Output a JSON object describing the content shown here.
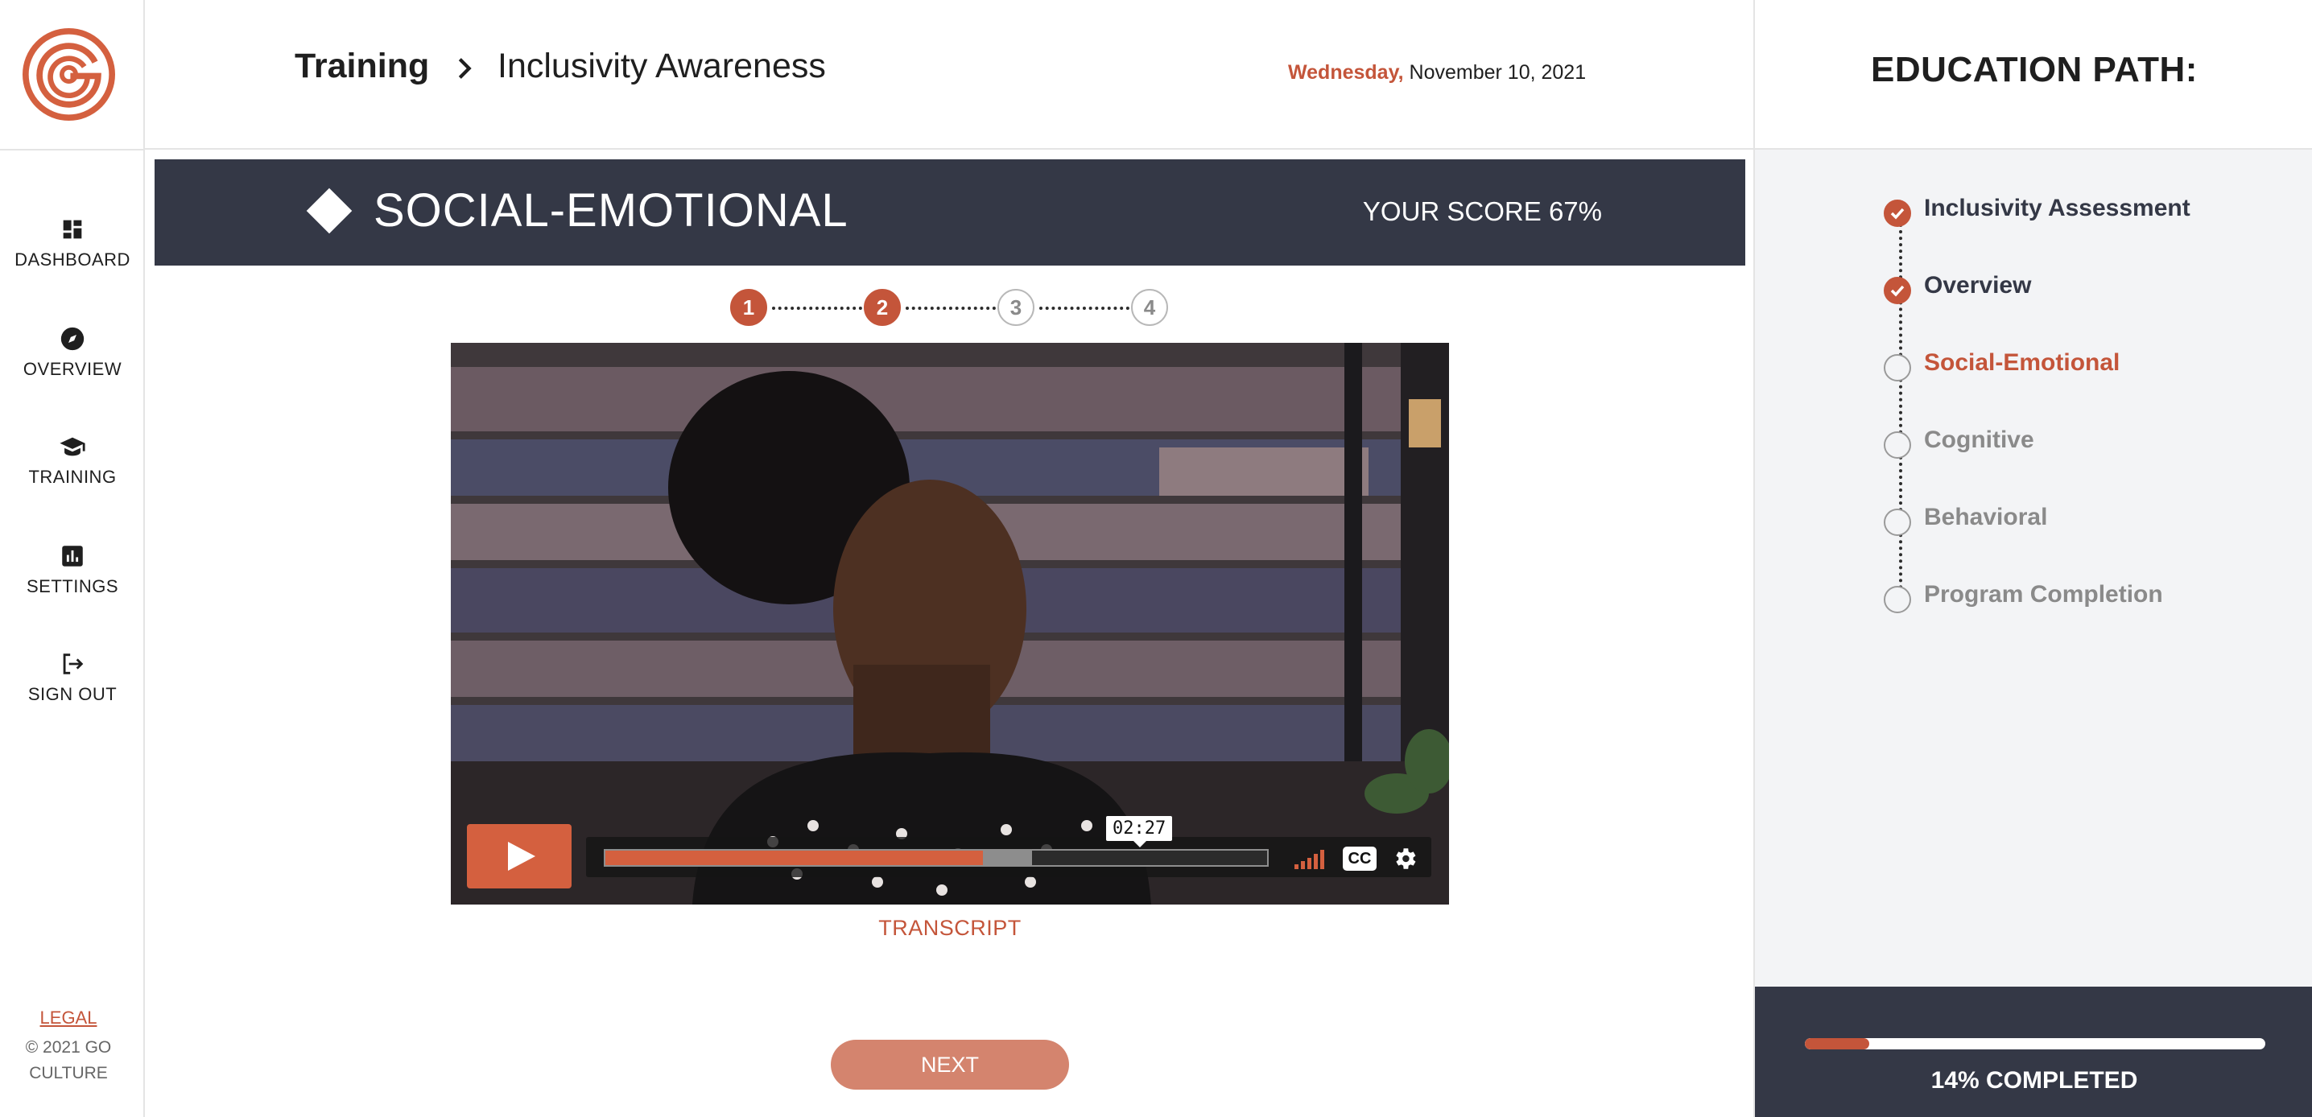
{
  "sidebar": {
    "items": [
      {
        "label": "DASHBOARD",
        "icon": "dashboard-icon"
      },
      {
        "label": "OVERVIEW",
        "icon": "compass-icon"
      },
      {
        "label": "TRAINING",
        "icon": "graduation-cap-icon"
      },
      {
        "label": "SETTINGS",
        "icon": "bar-chart-icon"
      },
      {
        "label": "SIGN OUT",
        "icon": "sign-out-icon"
      }
    ],
    "legal": "LEGAL",
    "copyright": "© 2021 GO CULTURE"
  },
  "header": {
    "breadcrumb_root": "Training",
    "breadcrumb_current": "Inclusivity Awareness",
    "date_day": "Wednesday,",
    "date_rest": " November 10, 2021"
  },
  "banner": {
    "title": "SOCIAL-EMOTIONAL",
    "score": "YOUR SCORE 67%"
  },
  "steps": [
    {
      "label": "1",
      "state": "done"
    },
    {
      "label": "2",
      "state": "done"
    },
    {
      "label": "3",
      "state": "todo"
    },
    {
      "label": "4",
      "state": "todo"
    }
  ],
  "video": {
    "time": "02:27",
    "played_fraction": 0.57,
    "buffered_fraction": 0.645,
    "cc_label": "CC"
  },
  "transcript_label": "TRANSCRIPT",
  "next_label": "NEXT",
  "education_path": {
    "title": "EDUCATION PATH:",
    "items": [
      {
        "label": "Inclusivity Assessment",
        "state": "done"
      },
      {
        "label": "Overview",
        "state": "done"
      },
      {
        "label": "Social-Emotional",
        "state": "active"
      },
      {
        "label": "Cognitive",
        "state": "todo"
      },
      {
        "label": "Behavioral",
        "state": "todo"
      },
      {
        "label": "Program Completion",
        "state": "todo"
      }
    ],
    "progress_percent": 14,
    "progress_label": "14% COMPLETED"
  },
  "colors": {
    "accent": "#c4553a",
    "banner_bg": "#343846",
    "next_button": "#d4846e"
  }
}
